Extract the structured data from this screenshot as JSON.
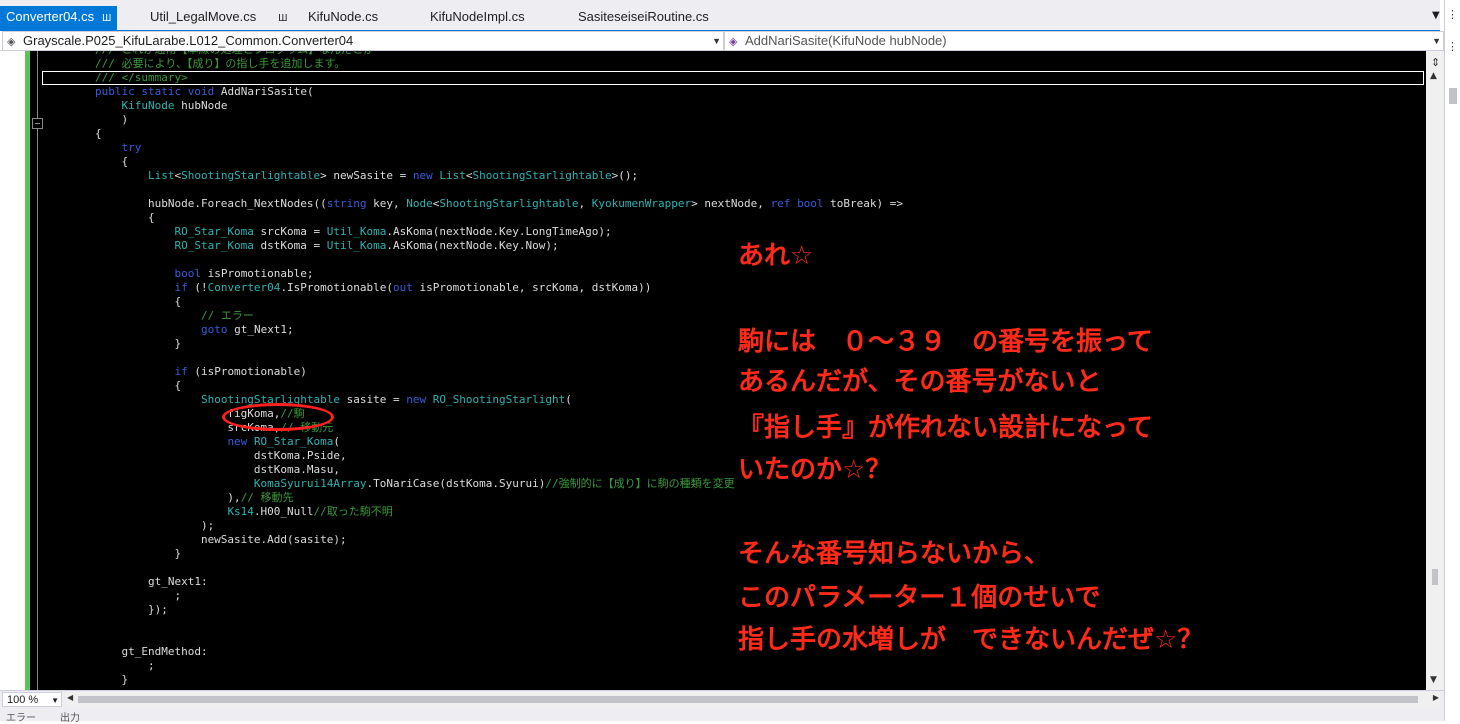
{
  "tabs": [
    {
      "label": "Converter04.cs",
      "pin": "Ш",
      "active": true
    },
    {
      "label": "Util_LegalMove.cs",
      "pin": "Ш",
      "active": false
    },
    {
      "label": "KifuNode.cs",
      "active": false
    },
    {
      "label": "KifuNodeImpl.cs",
      "active": false
    },
    {
      "label": "SasiteseiseiRoutine.cs",
      "active": false
    }
  ],
  "navbar": {
    "left_text": "Grayscale.P025_KifuLarabe.L012_Common.Converter04",
    "left_icon": "namespace-icon",
    "right_text": "AddNariSasite(KifuNode hubNode)",
    "right_icon": "method-icon"
  },
  "code_lines": [
    "        /// これが通常【本線の処理とプログラム】なんだとか",
    "        /// 必要により、【成り】の指し手を追加します。",
    "        /// </summary>",
    "        public static void AddNariSasite(",
    "            KifuNode hubNode",
    "            )",
    "        {",
    "            try",
    "            {",
    "                List<ShootingStarlightable> newSasite = new List<ShootingStarlightable>();",
    "",
    "                hubNode.Foreach_NextNodes((string key, Node<ShootingStarlightable, KyokumenWrapper> nextNode, ref bool toBreak) =>",
    "                {",
    "                    RO_Star_Koma srcKoma = Util_Koma.AsKoma(nextNode.Key.LongTimeAgo);",
    "                    RO_Star_Koma dstKoma = Util_Koma.AsKoma(nextNode.Key.Now);",
    "",
    "                    bool isPromotionable;",
    "                    if (!Converter04.IsPromotionable(out isPromotionable, srcKoma, dstKoma))",
    "                    {",
    "                        // エラー",
    "                        goto gt_Next1;",
    "                    }",
    "",
    "                    if (isPromotionable)",
    "                    {",
    "                        ShootingStarlightable sasite = new RO_ShootingStarlight(",
    "                            figKoma,//駒",
    "                            srcKoma,// 移動元",
    "                            new RO_Star_Koma(",
    "                                dstKoma.Pside,",
    "                                dstKoma.Masu,",
    "                                KomaSyurui14Array.ToNariCase(dstKoma.Syurui)//強制的に【成り】に駒の種類を変更",
    "                            ),// 移動先",
    "                            Ks14.H00_Null//取った駒不明",
    "                        );",
    "                        newSasite.Add(sasite);",
    "                    }",
    "",
    "                gt_Next1:",
    "                    ;",
    "                });",
    "",
    "",
    "            gt_EndMethod:",
    "                ;",
    "            }"
  ],
  "annotation_lines": [
    "あれ☆",
    "駒には　０～３９　の番号を振って",
    "あるんだが、その番号がないと",
    "『指し手』が作れない設計になって",
    "いたのか☆？",
    "そんな番号知らないから、",
    "このパラメーター１個のせいで",
    "指し手の水増しが　できないんだぜ☆？"
  ],
  "status": {
    "zoom": "100 %"
  },
  "bottom_tabs": [
    "エラー",
    "出力"
  ],
  "colors": {
    "editor_bg": "#000000",
    "keyword": "#3a5bd9",
    "type": "#2bb3b3",
    "comment": "#3a9a3a",
    "annotation": "#ff2a1a",
    "active_tab": "#0078d7",
    "change_bar": "#5cc35c"
  }
}
